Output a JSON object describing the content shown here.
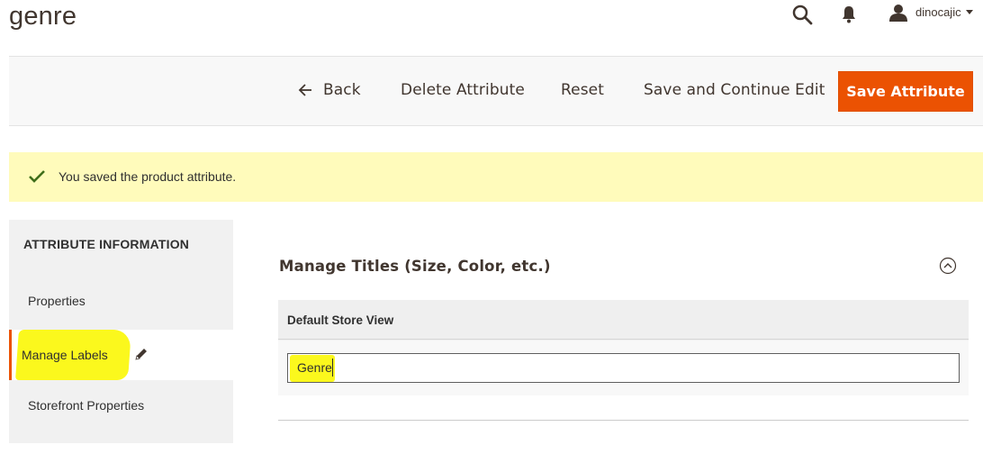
{
  "header": {
    "title": "genre",
    "user_name": "dinocajic"
  },
  "toolbar": {
    "back_label": "Back",
    "delete_label": "Delete Attribute",
    "reset_label": "Reset",
    "save_continue_label": "Save and Continue Edit",
    "save_label": "Save Attribute",
    "accent_color": "#eb5202"
  },
  "message": {
    "text": "You saved the product attribute.",
    "background": "#fffbbb"
  },
  "sidebar": {
    "heading": "ATTRIBUTE INFORMATION",
    "items": [
      {
        "label": "Properties",
        "active": false
      },
      {
        "label": "Manage Labels",
        "active": true
      },
      {
        "label": "Storefront Properties",
        "active": false
      }
    ]
  },
  "main": {
    "section_title": "Manage Titles (Size, Color, etc.)",
    "store_view_heading": "Default Store View",
    "store_view_value": "Genre",
    "highlight_color": "#fbf81d"
  },
  "icons": [
    "search-icon",
    "bell-icon",
    "user-icon",
    "chevron-down-icon",
    "arrow-left-icon",
    "check-icon",
    "pencil-icon",
    "collapse-icon"
  ]
}
